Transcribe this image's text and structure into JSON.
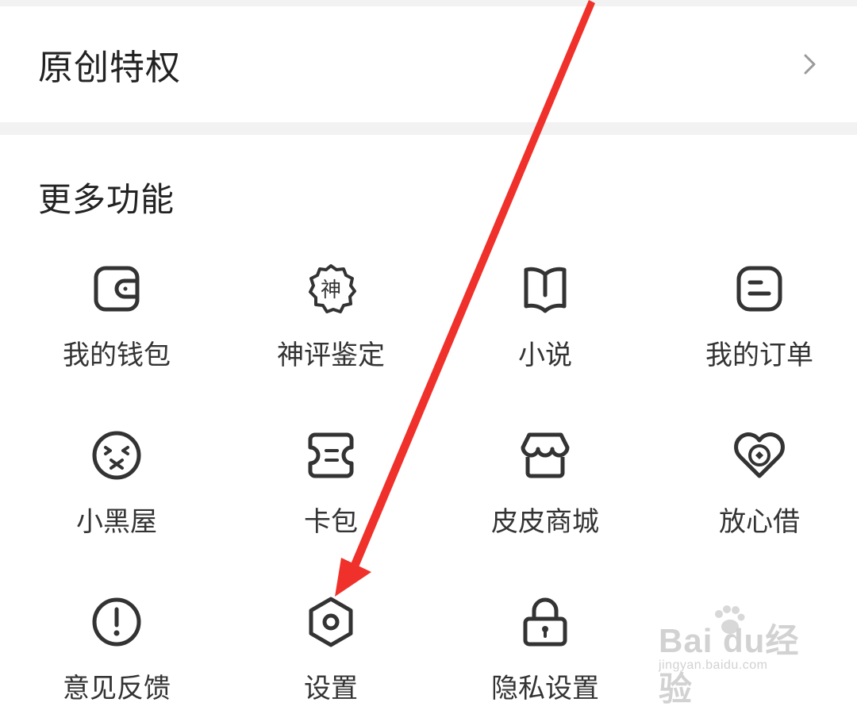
{
  "privilege": {
    "title": "原创特权"
  },
  "more": {
    "title": "更多功能",
    "items": [
      {
        "label": "我的钱包",
        "icon": "wallet-icon"
      },
      {
        "label": "神评鉴定",
        "icon": "shen-badge-icon",
        "badge_text": "神"
      },
      {
        "label": "小说",
        "icon": "book-icon"
      },
      {
        "label": "我的订单",
        "icon": "order-icon"
      },
      {
        "label": "小黑屋",
        "icon": "muted-face-icon"
      },
      {
        "label": "卡包",
        "icon": "ticket-icon"
      },
      {
        "label": "皮皮商城",
        "icon": "shop-icon"
      },
      {
        "label": "放心借",
        "icon": "heart-coin-icon"
      },
      {
        "label": "意见反馈",
        "icon": "exclamation-icon"
      },
      {
        "label": "设置",
        "icon": "settings-hexagon-icon"
      },
      {
        "label": "隐私设置",
        "icon": "lock-icon"
      }
    ]
  },
  "annotation": {
    "arrow_color": "#f0302a"
  },
  "watermark": {
    "brand": "Bai du经验",
    "url": "jingyan.baidu.com"
  },
  "colors": {
    "icon_stroke": "#333333",
    "text": "#222222",
    "separator": "#f2f2f2"
  }
}
